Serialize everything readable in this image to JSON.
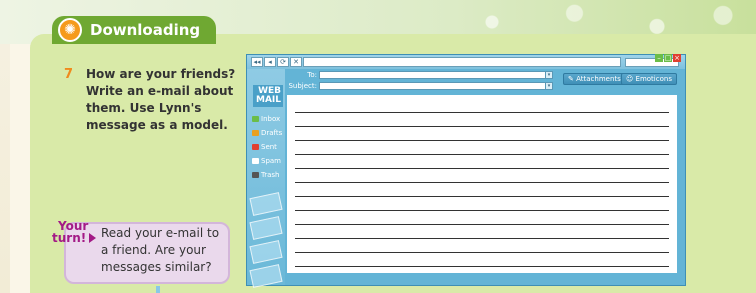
{
  "header": {
    "title": "Downloading",
    "icon": "sun-icon"
  },
  "question": {
    "number": "7",
    "lines": [
      "How are your friends?",
      "Write an e-mail about",
      "them. Use Lynn's",
      "message as a model."
    ]
  },
  "your_turn": {
    "badge_line1": "Your",
    "badge_line2": "turn!",
    "lines": [
      "Read your e-mail to",
      "a friend. Are your",
      "messages similar?"
    ]
  },
  "email": {
    "nav": [
      "◂◂",
      "◂",
      "⟳",
      "✕"
    ],
    "logo_line1": "WEB",
    "logo_line2": "MAIL",
    "folders": [
      {
        "label": "Inbox",
        "icon": "inbox-icon",
        "color": "#6bbd48"
      },
      {
        "label": "Drafts",
        "icon": "drafts-icon",
        "color": "#e8a020"
      },
      {
        "label": "Sent",
        "icon": "sent-icon",
        "color": "#e04030"
      },
      {
        "label": "Spam",
        "icon": "spam-icon",
        "color": "#ffffff"
      },
      {
        "label": "Trash",
        "icon": "trash-icon",
        "color": "#555555"
      }
    ],
    "to_label": "To:",
    "subject_label": "Subject:",
    "attachments_label": "Attachments",
    "emoticons_label": "Emoticons",
    "line_count": 12
  },
  "colors": {
    "panel": "#d9eaa8",
    "header": "#6fa832",
    "accent_orange": "#f08a1c",
    "your_turn_bg": "#ead9ec",
    "your_turn_text": "#a31a86",
    "email_frame": "#63b4d6"
  }
}
